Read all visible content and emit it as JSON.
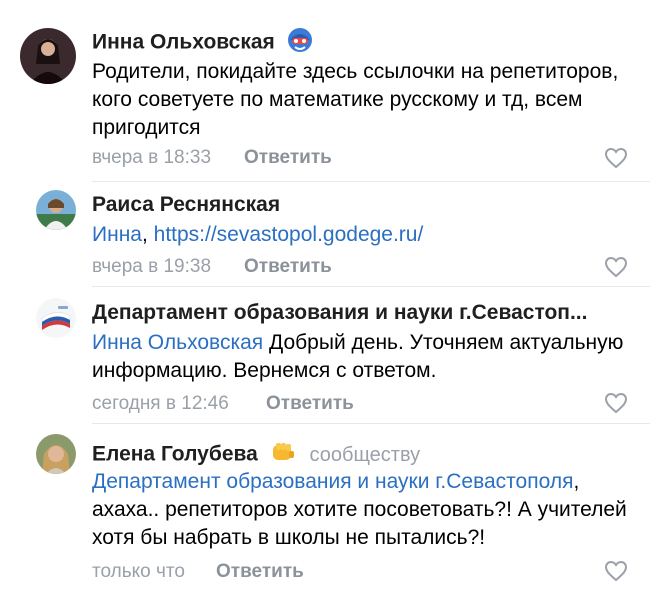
{
  "comments": [
    {
      "author": "Инна Ольховская",
      "text": "Родители, покидайте здесь ссылочки на репетиторов, кого советуете по математике русскому и тд, всем пригодится",
      "time": "вчера в 18:33",
      "reply": "Ответить"
    },
    {
      "author": "Раиса Реснянская",
      "mention": "Инна",
      "link": "https://sevastopol.godege.ru/",
      "time": "вчера в 19:38",
      "reply": "Ответить"
    },
    {
      "author": "Департамент образования и науки г.Севастоп...",
      "mention": "Инна Ольховская",
      "text": " Добрый день.  Уточняем актуальную информацию. Вернемся с ответом.",
      "time": "сегодня в 12:46",
      "reply": "Ответить"
    },
    {
      "author": "Елена Голубева",
      "tag": "сообществу",
      "mention": "Департамент образования и науки г.Севастополя",
      "text": ", ахаха.. репетиторов хотите посоветовать?! А учителей хотя бы набрать в школы не пытались?!",
      "time": "только что",
      "reply": "Ответить"
    }
  ],
  "colors": {
    "link": "#2a6fc2",
    "meta": "#9aa0a8",
    "reply": "#8b929a"
  }
}
